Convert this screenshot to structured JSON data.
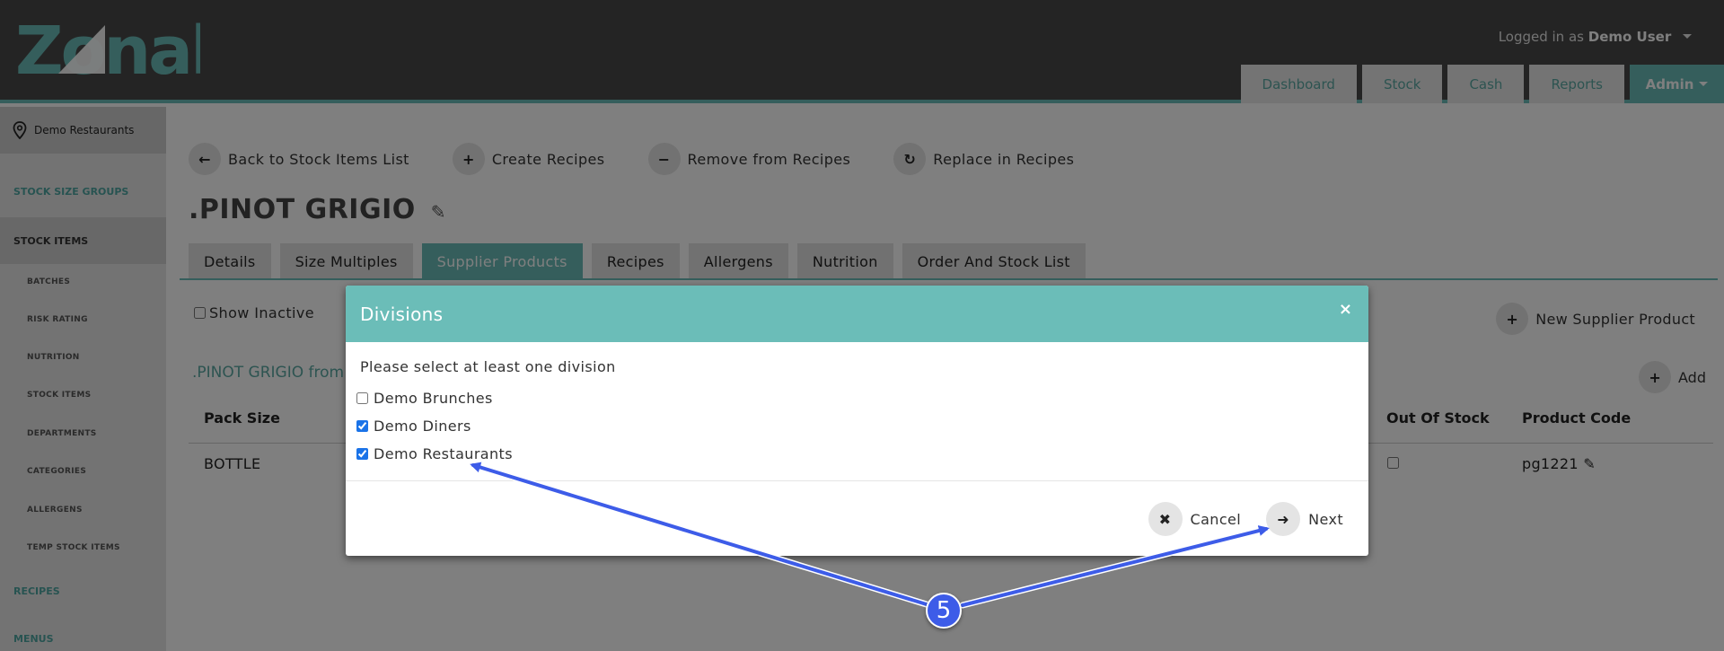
{
  "header": {
    "logo_text": "Zonal",
    "logged_in_prefix": "Logged in as",
    "user_name": "Demo User",
    "nav": [
      "Dashboard",
      "Stock",
      "Cash",
      "Reports",
      "Admin"
    ]
  },
  "sidebar": {
    "location": "Demo Restaurants",
    "items": [
      {
        "label": "STOCK SIZE GROUPS"
      },
      {
        "label": "STOCK ITEMS"
      },
      {
        "label": "BATCHES"
      },
      {
        "label": "RISK RATING"
      },
      {
        "label": "NUTRITION"
      },
      {
        "label": "STOCK ITEMS"
      },
      {
        "label": "DEPARTMENTS"
      },
      {
        "label": "CATEGORIES"
      },
      {
        "label": "ALLERGENS"
      },
      {
        "label": "TEMP STOCK ITEMS"
      },
      {
        "label": "RECIPES"
      },
      {
        "label": "MENUS"
      }
    ]
  },
  "actions": [
    {
      "label": "Back to Stock Items List",
      "icon": "arrow-left-icon"
    },
    {
      "label": "Create Recipes",
      "icon": "plus-icon"
    },
    {
      "label": "Remove from Recipes",
      "icon": "minus-icon"
    },
    {
      "label": "Replace in Recipes",
      "icon": "refresh-icon"
    }
  ],
  "page": {
    "title": ".PINOT GRIGIO",
    "tabs": [
      "Details",
      "Size Multiples",
      "Supplier Products",
      "Recipes",
      "Allergens",
      "Nutrition",
      "Order And Stock List"
    ],
    "show_inactive": "Show Inactive",
    "new_supplier_product": "New Supplier Product",
    "section_title": ".PINOT GRIGIO from",
    "add": "Add",
    "table": {
      "headers": {
        "pack_size": "Pack Size",
        "out_of_stock": "Out Of Stock",
        "product_code": "Product Code"
      },
      "row": {
        "pack_size": "BOTTLE",
        "product_code": "pg1221"
      }
    }
  },
  "modal": {
    "title": "Divisions",
    "close": "×",
    "instruction": "Please select at least one division",
    "divisions": [
      {
        "label": "Demo Brunches",
        "checked": false
      },
      {
        "label": "Demo Diners",
        "checked": true
      },
      {
        "label": "Demo Restaurants",
        "checked": true
      }
    ],
    "cancel": "Cancel",
    "next": "Next"
  },
  "annotation": {
    "step": "5",
    "color": "#3d5ce8"
  },
  "colors": {
    "teal": "#6bbdb8",
    "header_bg": "#484848"
  }
}
